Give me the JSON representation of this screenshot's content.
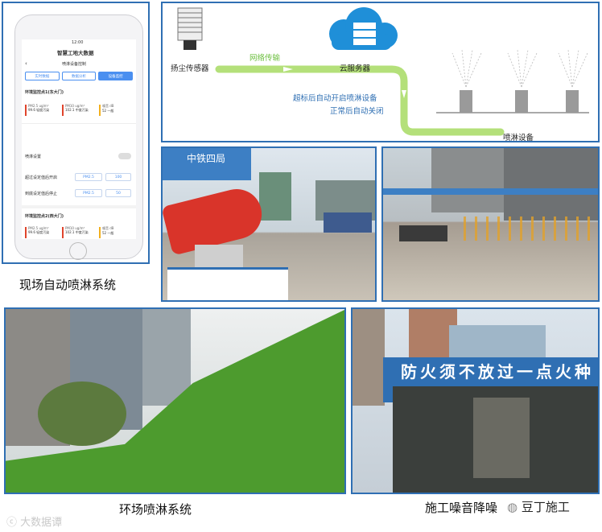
{
  "phone": {
    "status_time": "12:00",
    "app_title": "智慧工地大数据",
    "page_title": "喷淋设备控制",
    "tabs": [
      {
        "label": "实时数据",
        "active": false
      },
      {
        "label": "数据分析",
        "active": false
      },
      {
        "label": "设备监控",
        "active": true
      }
    ],
    "section1": "环境监控点1(东大门)",
    "readings": [
      {
        "label": "PM2.5 ug/m³",
        "value": "99.6 轻度污染"
      },
      {
        "label": "PM10 ug/m³",
        "value": "102.1 中度污染"
      },
      {
        "label": "噪音 dB",
        "value": "52 一般"
      }
    ],
    "spray_setting": "喷淋设置",
    "rule_on_label": "超过设定值后开启",
    "rule_on_param": "PM2.5",
    "rule_on_value": "100",
    "rule_off_label": "到底设定值后停止",
    "rule_off_param": "PM2.5",
    "rule_off_value": "50",
    "section2": "环境监控点2(西大门)",
    "readings2": [
      {
        "label": "PM2.5 ug/m³",
        "value": "99.6 轻度污染"
      },
      {
        "label": "PM10 ug/m³",
        "value": "102.1 中度污染"
      },
      {
        "label": "噪音 dB",
        "value": "52 一般"
      }
    ]
  },
  "diagram": {
    "sensor_label": "扬尘传感器",
    "network_label": "网络传输",
    "server_label": "云服务器",
    "rule_on": "超标后自动开启喷淋设备",
    "rule_off": "正常后自动关闭",
    "sprinkler_label": "喷淋设备"
  },
  "photos": {
    "cannon_sign": "中铁四局",
    "tent_banner": "防火须不放过一点火种"
  },
  "captions": {
    "auto_spray": "现场自动喷淋系统",
    "ring_spray": "环场喷淋系统",
    "noise": "施工噪音降噪",
    "watermark_left": "大数据谭",
    "watermark_right": "豆丁施工"
  },
  "colors": {
    "frame": "#2f6fb3",
    "pipe": "#b4e07a",
    "cloud": "#1f8fd8",
    "rule_text": "#2f6fb3",
    "grass": "#4d9b2e"
  }
}
